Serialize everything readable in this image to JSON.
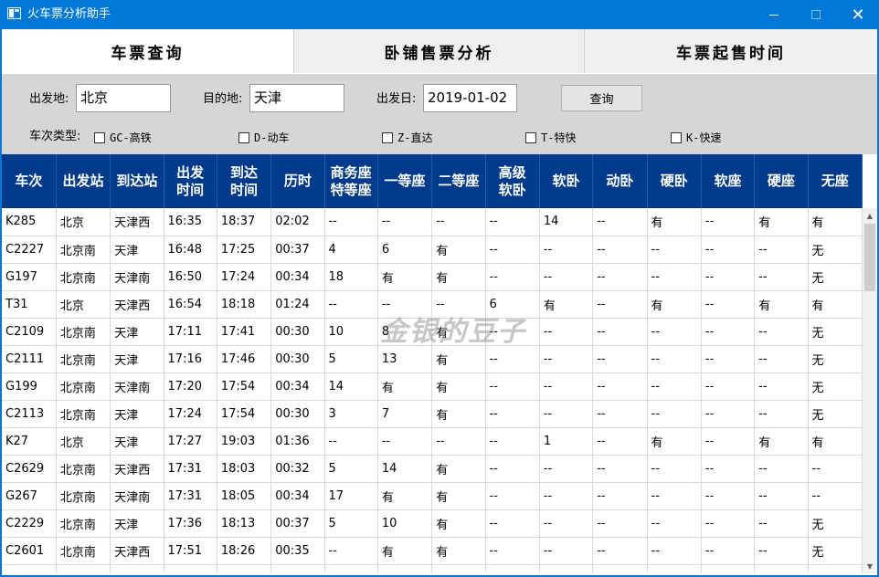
{
  "window": {
    "title": "火车票分析助手",
    "minimize_glyph": "—",
    "close_glyph": "✕"
  },
  "tabs": [
    {
      "label": "车票查询"
    },
    {
      "label": "卧铺售票分析"
    },
    {
      "label": "车票起售时间"
    }
  ],
  "search": {
    "from_label": "出发地:",
    "from_value": "北京",
    "to_label": "目的地:",
    "to_value": "天津",
    "date_label": "出发日:",
    "date_value": "2019-01-02",
    "query_button": "查询",
    "type_label": "车次类型:",
    "types": [
      "GC-高铁",
      "D-动车",
      "Z-直达",
      "T-特快",
      "K-快速"
    ]
  },
  "table": {
    "columns": [
      "车次",
      "出发站",
      "到达站",
      "出发\n时间",
      "到达\n时间",
      "历时",
      "商务座\n特等座",
      "一等座",
      "二等座",
      "高级\n软卧",
      "软卧",
      "动卧",
      "硬卧",
      "软座",
      "硬座",
      "无座"
    ],
    "rows": [
      [
        "K285",
        "北京",
        "天津西",
        "16:35",
        "18:37",
        "02:02",
        "--",
        "--",
        "--",
        "--",
        "14",
        "--",
        "有",
        "--",
        "有",
        "有"
      ],
      [
        "C2227",
        "北京南",
        "天津",
        "16:48",
        "17:25",
        "00:37",
        "4",
        "6",
        "有",
        "--",
        "--",
        "--",
        "--",
        "--",
        "--",
        "无"
      ],
      [
        "G197",
        "北京南",
        "天津南",
        "16:50",
        "17:24",
        "00:34",
        "18",
        "有",
        "有",
        "--",
        "--",
        "--",
        "--",
        "--",
        "--",
        "无"
      ],
      [
        "T31",
        "北京",
        "天津西",
        "16:54",
        "18:18",
        "01:24",
        "--",
        "--",
        "--",
        "6",
        "有",
        "--",
        "有",
        "--",
        "有",
        "有"
      ],
      [
        "C2109",
        "北京南",
        "天津",
        "17:11",
        "17:41",
        "00:30",
        "10",
        "8",
        "有",
        "--",
        "--",
        "--",
        "--",
        "--",
        "--",
        "无"
      ],
      [
        "C2111",
        "北京南",
        "天津",
        "17:16",
        "17:46",
        "00:30",
        "5",
        "13",
        "有",
        "--",
        "--",
        "--",
        "--",
        "--",
        "--",
        "无"
      ],
      [
        "G199",
        "北京南",
        "天津南",
        "17:20",
        "17:54",
        "00:34",
        "14",
        "有",
        "有",
        "--",
        "--",
        "--",
        "--",
        "--",
        "--",
        "无"
      ],
      [
        "C2113",
        "北京南",
        "天津",
        "17:24",
        "17:54",
        "00:30",
        "3",
        "7",
        "有",
        "--",
        "--",
        "--",
        "--",
        "--",
        "--",
        "无"
      ],
      [
        "K27",
        "北京",
        "天津",
        "17:27",
        "19:03",
        "01:36",
        "--",
        "--",
        "--",
        "--",
        "1",
        "--",
        "有",
        "--",
        "有",
        "有"
      ],
      [
        "C2629",
        "北京南",
        "天津西",
        "17:31",
        "18:03",
        "00:32",
        "5",
        "14",
        "有",
        "--",
        "--",
        "--",
        "--",
        "--",
        "--",
        "--"
      ],
      [
        "G267",
        "北京南",
        "天津南",
        "17:31",
        "18:05",
        "00:34",
        "17",
        "有",
        "有",
        "--",
        "--",
        "--",
        "--",
        "--",
        "--",
        "--"
      ],
      [
        "C2229",
        "北京南",
        "天津",
        "17:36",
        "18:13",
        "00:37",
        "5",
        "10",
        "有",
        "--",
        "--",
        "--",
        "--",
        "--",
        "--",
        "无"
      ],
      [
        "C2601",
        "北京南",
        "天津西",
        "17:51",
        "18:26",
        "00:35",
        "--",
        "有",
        "有",
        "--",
        "--",
        "--",
        "--",
        "--",
        "--",
        "无"
      ],
      [
        "",
        "",
        "",
        "",
        "",
        "",
        "",
        "",
        "",
        "",
        "",
        "",
        "",
        "",
        "",
        ""
      ]
    ]
  },
  "watermark": "金银的豆子",
  "scrollbar": {
    "up_glyph": "▲",
    "down_glyph": "▼"
  }
}
